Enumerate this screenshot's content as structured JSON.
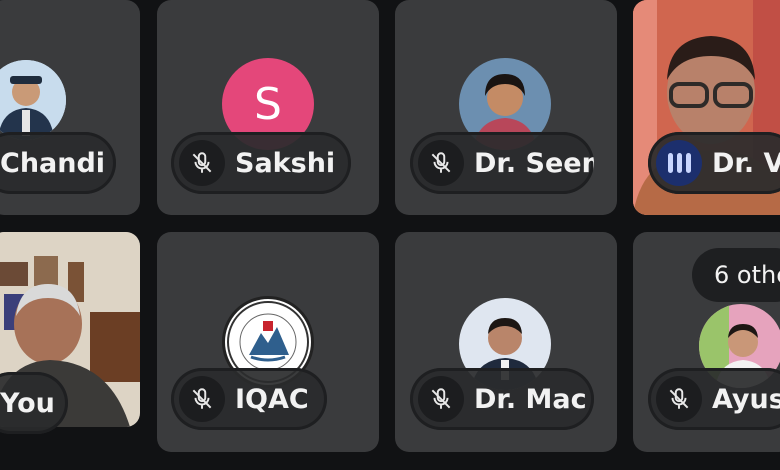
{
  "participants": [
    {
      "name": "Chandi",
      "muted": true
    },
    {
      "name": "Sakshi",
      "muted": true,
      "initial": "S"
    },
    {
      "name": "Dr. Seema",
      "muted": true
    },
    {
      "name": "Dr. V",
      "muted": false,
      "speaking": true
    },
    {
      "name": "You",
      "muted": false
    },
    {
      "name": "IQAC",
      "muted": true
    },
    {
      "name": "Dr. Mac",
      "muted": true
    },
    {
      "name": "Ayus",
      "muted": true
    }
  ],
  "others_label": "6 othe",
  "colors": {
    "tile_bg": "#3a3b3d",
    "page_bg": "#111214",
    "speaking_accent": "#1c2f6d",
    "sakshi_avatar": "#e4477a"
  }
}
